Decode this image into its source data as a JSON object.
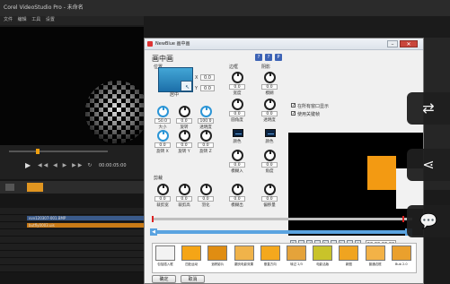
{
  "background_app": {
    "title": "Corel VideoStudio Pro - 未命名",
    "menu": [
      "文件",
      "编辑",
      "工具",
      "设置"
    ],
    "timecode": "00:00:05:00",
    "track_clips": [
      {
        "label": "vvv120307-001.BMP"
      },
      {
        "label": "butfly0003.uis"
      }
    ]
  },
  "dialog": {
    "title": "NewBlue 画中画",
    "heading": "画中画",
    "help_buttons": [
      "?",
      "?",
      "P"
    ],
    "position": {
      "label": "位置",
      "x_label": "X",
      "x_value": "0.0",
      "y_label": "Y",
      "y_value": "0.0",
      "button_label": "居中"
    },
    "size_group": [
      {
        "value": "50.0",
        "label": "大小"
      },
      {
        "value": "0.0",
        "label": "旋转"
      },
      {
        "value": "100.0",
        "label": "透明度"
      }
    ],
    "rotate_group": [
      {
        "value": "0.0",
        "label": "旋转 X"
      },
      {
        "value": "0.0",
        "label": "旋转 Y"
      },
      {
        "value": "0.0",
        "label": "旋转 Z"
      }
    ],
    "crop": {
      "label": "剪裁",
      "knobs": [
        {
          "value": "0.0",
          "label": "裁剪宽"
        },
        {
          "value": "0.0",
          "label": "裁剪高"
        },
        {
          "value": "0.0",
          "label": "羽化"
        }
      ]
    },
    "border": {
      "label": "边框",
      "knobs": [
        {
          "value": "0.0",
          "label": "宽度"
        },
        {
          "value": "0.0",
          "label": "圆角度"
        },
        {
          "value": "0.0",
          "label": "模糊入"
        },
        {
          "value": "0.0",
          "label": "模糊出"
        }
      ],
      "color_label": "颜色"
    },
    "shadow": {
      "label": "阴影",
      "knobs": [
        {
          "value": "0.0",
          "label": "模糊"
        },
        {
          "value": "0.0",
          "label": "透明度"
        },
        {
          "value": "0.0",
          "label": "角度"
        },
        {
          "value": "0.0",
          "label": "偏移量"
        }
      ],
      "color_label": "颜色"
    },
    "checkboxes": [
      {
        "label": "在所有窗口显示",
        "checked": true
      },
      {
        "label": "使用关键帧",
        "checked": true
      }
    ],
    "time": "00:00:06.00",
    "presets": [
      {
        "label": "包括插入框",
        "color": "#f3f3f3"
      },
      {
        "label": "四处运动",
        "color": "#f5a516"
      },
      {
        "label": "追踪影片",
        "color": "#e08d12"
      },
      {
        "label": "翻页电影效果",
        "color": "#f0b34a"
      },
      {
        "label": "垂直方向",
        "color": "#f4a81d"
      },
      {
        "label": "转过 2/3",
        "color": "#e5a33a"
      },
      {
        "label": "电影活版",
        "color": "#c9c32a"
      },
      {
        "label": "新图",
        "color": "#f0a420"
      },
      {
        "label": "普通边框",
        "color": "#f3b247"
      },
      {
        "label": "Bub 2.0",
        "color": "#eaa02d"
      }
    ],
    "ok_label": "确定",
    "cancel_label": "取消"
  },
  "float_buttons": [
    {
      "icon": "swap-icon",
      "glyph": "⇄"
    },
    {
      "icon": "share-icon",
      "glyph": "⋖"
    },
    {
      "icon": "comment-icon",
      "glyph": "💬"
    }
  ]
}
